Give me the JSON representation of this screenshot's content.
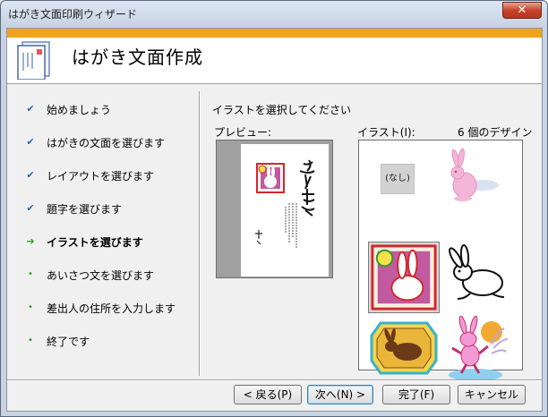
{
  "window": {
    "title": "はがき文面印刷ウィザード",
    "close_label": "✕"
  },
  "header": {
    "title": "はがき文面作成"
  },
  "steps": [
    {
      "label": "始めましょう",
      "state": "done"
    },
    {
      "label": "はがきの文面を選びます",
      "state": "done"
    },
    {
      "label": "レイアウトを選びます",
      "state": "done"
    },
    {
      "label": "題字を選びます",
      "state": "done"
    },
    {
      "label": "イラストを選びます",
      "state": "current"
    },
    {
      "label": "あいさつ文を選びます",
      "state": "pending"
    },
    {
      "label": "差出人の住所を入力します",
      "state": "pending"
    },
    {
      "label": "終了です",
      "state": "pending"
    }
  ],
  "marks": {
    "done": "✔",
    "current": "➔",
    "pending": "•"
  },
  "main": {
    "instruction": "イラストを選択してください",
    "preview_label": "プレビュー:",
    "illust_label": "イラスト(I):",
    "count_label": "6 個のデザイン",
    "none_label": "(なし)",
    "postcard_title": "運 賀",
    "postcard_greeting": "あけましておめでとうございます\n本年もよろしくお願い申し上げます",
    "postcard_year": "元旦"
  },
  "illustrations": [
    {
      "name": "none"
    },
    {
      "name": "pink-rabbit"
    },
    {
      "name": "stamp-rabbit",
      "selected": true
    },
    {
      "name": "outline-rabbit"
    },
    {
      "name": "gold-rabbit"
    },
    {
      "name": "dancing-rabbit"
    }
  ],
  "buttons": {
    "back": "< 戻る(P)",
    "next": "次へ(N) >",
    "finish": "完了(F)",
    "cancel": "キャンセル"
  },
  "colors": {
    "accent": "#f2a31b",
    "check": "#2e63b8",
    "arrow": "#2d9a2d"
  }
}
